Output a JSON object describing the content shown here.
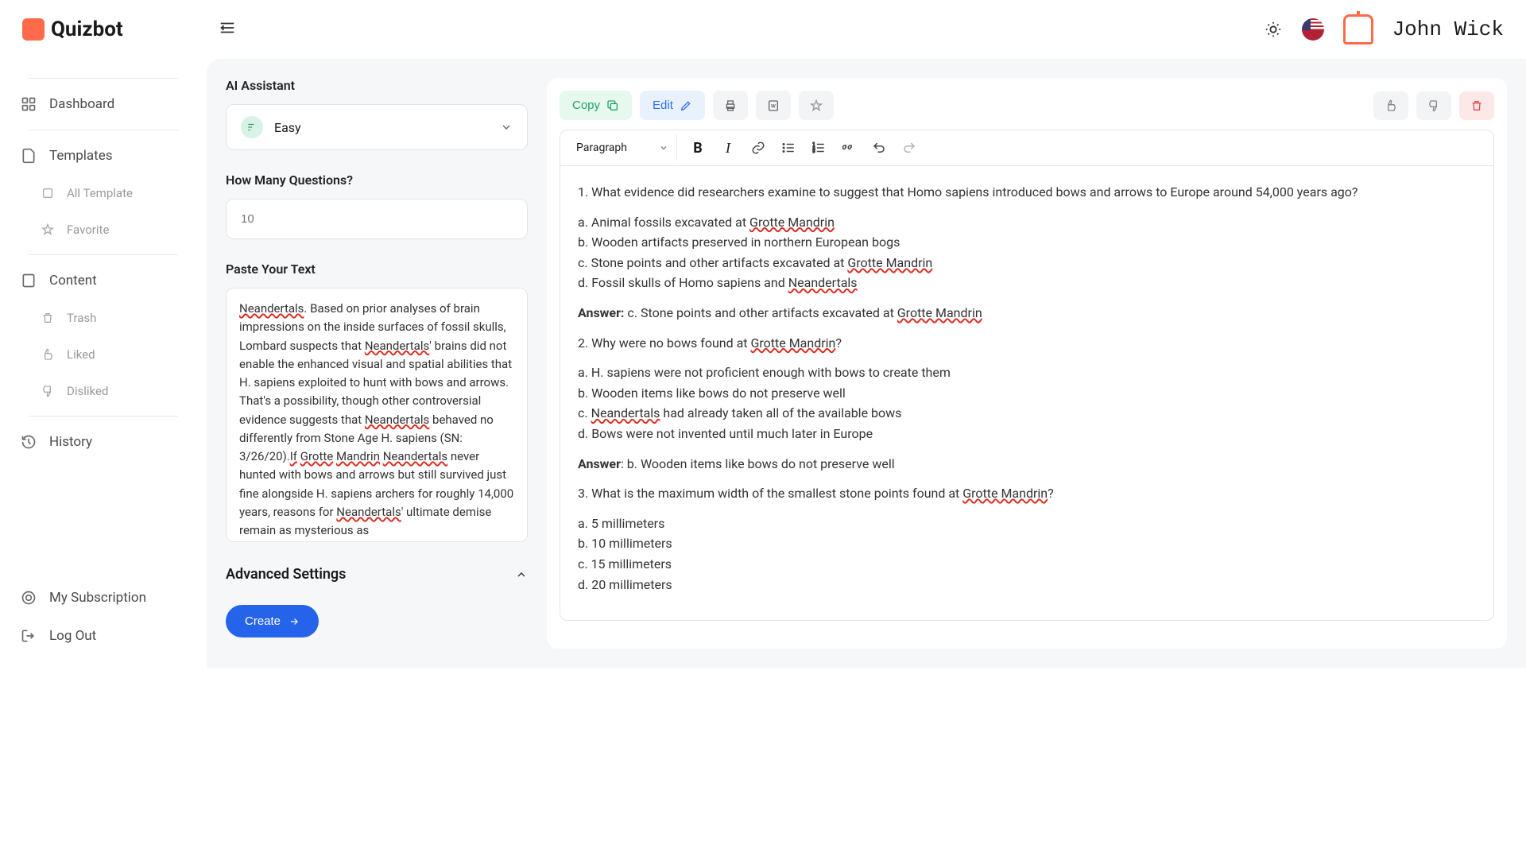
{
  "header": {
    "brand": "Quizbot",
    "user": "John Wick"
  },
  "sidebar": {
    "dashboard": "Dashboard",
    "templates": "Templates",
    "all_template": "All Template",
    "favorite": "Favorite",
    "content": "Content",
    "trash": "Trash",
    "liked": "Liked",
    "disliked": "Disliked",
    "history": "History",
    "subscription": "My Subscription",
    "logout": "Log Out"
  },
  "form": {
    "ai_label": "AI Assistant",
    "difficulty": "Easy",
    "qcount_label": "How Many Questions?",
    "qcount_value": "10",
    "paste_label": "Paste Your Text",
    "paste_text_plain": "Neandertals. Based on prior analyses of brain impressions on the inside surfaces of fossil skulls, Lombard suspects that Neandertals' brains did not enable the enhanced visual and spatial abilities that H. sapiens exploited to hunt with bows and arrows. That's a possibility, though other controversial evidence suggests that Neandertals behaved no differently from Stone Age H. sapiens (SN: 3/26/20).If Grotte Mandrin Neandertals never hunted with bows and arrows but still survived just fine alongside H. sapiens archers for roughly 14,000 years, reasons for Neandertals' ultimate demise remain as mysterious as",
    "advanced": "Advanced Settings",
    "create": "Create"
  },
  "output": {
    "copy": "Copy",
    "edit": "Edit",
    "format_label": "Paragraph",
    "q1": "1. What evidence did researchers examine to suggest that Homo sapiens introduced bows and arrows to Europe around 54,000 years ago?",
    "q1a": "a. Animal fossils excavated at ",
    "q1a_u": "Grotte Mandrin",
    "q1b": "b. Wooden artifacts preserved in northern European bogs",
    "q1c": "c. Stone points and other artifacts excavated at ",
    "q1c_u": "Grotte Mandrin",
    "q1d": "d. Fossil skulls of Homo sapiens and ",
    "q1d_u": "Neandertals",
    "ans1_label": "Answer:",
    "ans1": " c. Stone points and other artifacts excavated at ",
    "ans1_u": "Grotte Mandrin",
    "q2": "2. Why were no bows found at ",
    "q2_u": "Grotte Mandrin",
    "q2_end": "?",
    "q2a": "a. H. sapiens were not proficient enough with bows to create them",
    "q2b": "b. Wooden items like bows do not preserve well",
    "q2c": "c. ",
    "q2c_u": "Neandertals",
    "q2c_end": " had already taken all of the available bows",
    "q2d": "d. Bows were not invented until much later in Europe",
    "ans2_label": "Answer",
    "ans2": ": b. Wooden items like bows do not preserve well",
    "q3": "3. What is the maximum width of the smallest stone points found at ",
    "q3_u": "Grotte Mandrin",
    "q3_end": "?",
    "q3a": "a. 5 millimeters",
    "q3b": "b. 10 millimeters",
    "q3c": "c. 15 millimeters",
    "q3d": "d. 20 millimeters"
  }
}
